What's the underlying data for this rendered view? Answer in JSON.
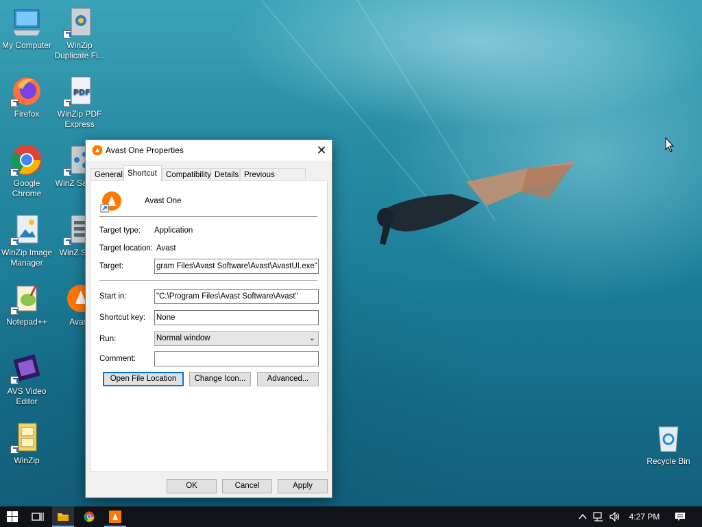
{
  "desktop": {
    "icons_left": [
      {
        "label": "My Computer"
      },
      {
        "label": "Firefox"
      },
      {
        "label": "Google Chrome"
      },
      {
        "label": "WinZip Image Manager"
      },
      {
        "label": "Notepad++"
      },
      {
        "label": "AVS Video Editor"
      },
      {
        "label": "WinZip"
      }
    ],
    "icons_second": [
      {
        "label": "WinZip Duplicate Fi..."
      },
      {
        "label": "WinZip PDF Express"
      },
      {
        "label": "WinZ SafeSh"
      },
      {
        "label": "WinZ Secu"
      },
      {
        "label": "Avast"
      }
    ],
    "recycle_bin": "Recycle Bin"
  },
  "dialog": {
    "title": "Avast One Properties",
    "tabs": [
      "General",
      "Shortcut",
      "Compatibility",
      "Details",
      "Previous Versions"
    ],
    "active_tab": "Shortcut",
    "app_name": "Avast One",
    "target_type_label": "Target type:",
    "target_type_value": "Application",
    "target_location_label": "Target location:",
    "target_location_value": "Avast",
    "target_label": "Target:",
    "target_value": "gram Files\\Avast Software\\Avast\\AvastUI.exe\"",
    "start_in_label": "Start in:",
    "start_in_value": "\"C:\\Program Files\\Avast Software\\Avast\"",
    "shortcut_key_label": "Shortcut key:",
    "shortcut_key_value": "None",
    "run_label": "Run:",
    "run_value": "Normal window",
    "comment_label": "Comment:",
    "comment_value": "",
    "open_file_location": "Open File Location",
    "change_icon": "Change Icon...",
    "advanced": "Advanced...",
    "ok": "OK",
    "cancel": "Cancel",
    "apply": "Apply"
  },
  "taskbar": {
    "time": "4:27 PM"
  },
  "colors": {
    "accent": "#0078d7",
    "avast_orange": "#ff7800",
    "taskbar": "#101418"
  }
}
